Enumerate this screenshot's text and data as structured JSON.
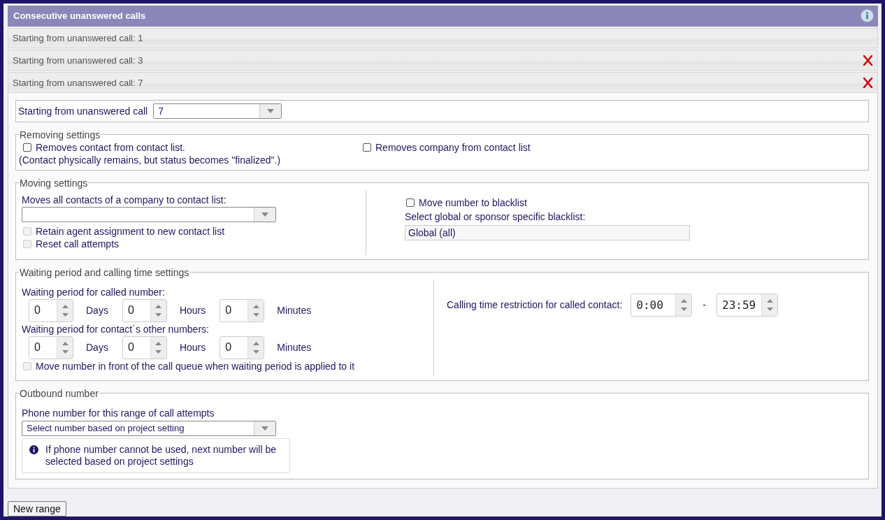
{
  "panel": {
    "title": "Consecutive unanswered calls"
  },
  "ranges": [
    {
      "label": "Starting from unanswered call: 1",
      "removable": false,
      "expanded": false
    },
    {
      "label": "Starting from unanswered call: 3",
      "removable": true,
      "expanded": false
    },
    {
      "label": "Starting from unanswered call: 7",
      "removable": true,
      "expanded": true
    }
  ],
  "editor": {
    "start": {
      "label": "Starting from unanswered call",
      "value": "7"
    },
    "removing": {
      "legend": "Removing settings",
      "options": [
        {
          "label": "Removes contact from contact list.",
          "note": "(Contact physically remains, but status becomes \"finalized\".)",
          "checked": false,
          "disabled": false
        },
        {
          "label": "Removes company from contact list",
          "checked": false,
          "disabled": false
        }
      ]
    },
    "moving": {
      "legend": "Moving settings",
      "list_label": "Moves all contacts of a company to contact list:",
      "options": [
        {
          "label": "Retain agent assignment to new contact list",
          "checked": false,
          "disabled": true
        },
        {
          "label": "Reset call attempts",
          "checked": false,
          "disabled": true
        }
      ],
      "blacklist": {
        "label": "Move number to blacklist",
        "checked": false,
        "disabled": false
      },
      "blacklist_label": "Select global or sponsor specific blacklist:",
      "blacklist_value": "Global (all)"
    },
    "waiting": {
      "legend": "Waiting period and calling time settings",
      "groups": [
        {
          "label": "Waiting period for called number:",
          "fields": [
            {
              "value": "0",
              "unit": "Days"
            },
            {
              "value": "0",
              "unit": "Hours"
            },
            {
              "value": "0",
              "unit": "Minutes"
            }
          ]
        },
        {
          "label": "Waiting period for contact´s other numbers:",
          "fields": [
            {
              "value": "0",
              "unit": "Days"
            },
            {
              "value": "0",
              "unit": "Hours"
            },
            {
              "value": "0",
              "unit": "Minutes"
            }
          ]
        }
      ],
      "front_option": {
        "label": "Move number in front of the call queue when waiting period is applied to it",
        "checked": false,
        "disabled": true
      },
      "time": {
        "label": "Calling time restriction for called contact:",
        "from": "0:00",
        "separator": "-",
        "to": "23:59"
      }
    },
    "outbound": {
      "legend": "Outbound number",
      "label": "Phone number for this range of call attempts",
      "value": "Select number based on project setting",
      "info": "If phone number cannot be used, next number will be selected based on project settings"
    }
  },
  "buttons": [
    {
      "label": "New range"
    }
  ]
}
